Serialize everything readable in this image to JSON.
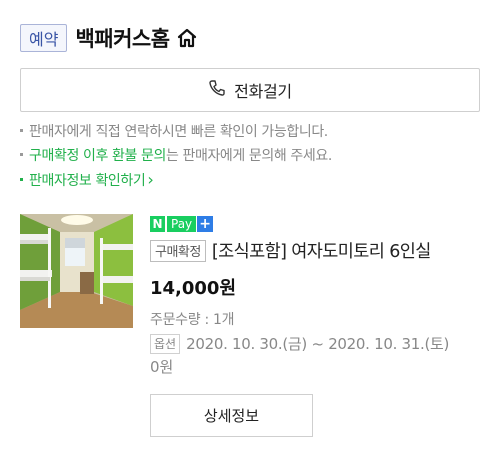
{
  "header": {
    "badge": "예약",
    "store_name": "백패커스홈",
    "home_icon": "home-icon"
  },
  "call_button": {
    "icon": "phone-icon",
    "label": "전화걸기"
  },
  "notices": {
    "line1": "판매자에게 직접 연락하시면 빠른 확인이 가능합니다.",
    "line2_highlight": "구매확정 이후 환불 문의",
    "line2_rest": "는 판매자에게 문의해 주세요.",
    "line3_link": "판매자정보 확인하기",
    "line3_arrow": "›"
  },
  "order": {
    "npay": {
      "n": "N",
      "pay": "Pay",
      "plus": "+"
    },
    "status_badge": "구매확정",
    "product_name": "[조식포함] 여자도미토리 6인실",
    "price": "14,000원",
    "quantity": "주문수량 : 1개",
    "option_badge": "옵션",
    "option_text": "2020. 10. 30.(금) ~ 2020. 10. 31.(토)",
    "option_extra": "0원",
    "detail_button": "상세정보"
  },
  "colors": {
    "green": "#21b04b",
    "npay_green": "#19ce60",
    "npay_blue": "#2e7de6",
    "badge_blue": "#3a55a6"
  }
}
